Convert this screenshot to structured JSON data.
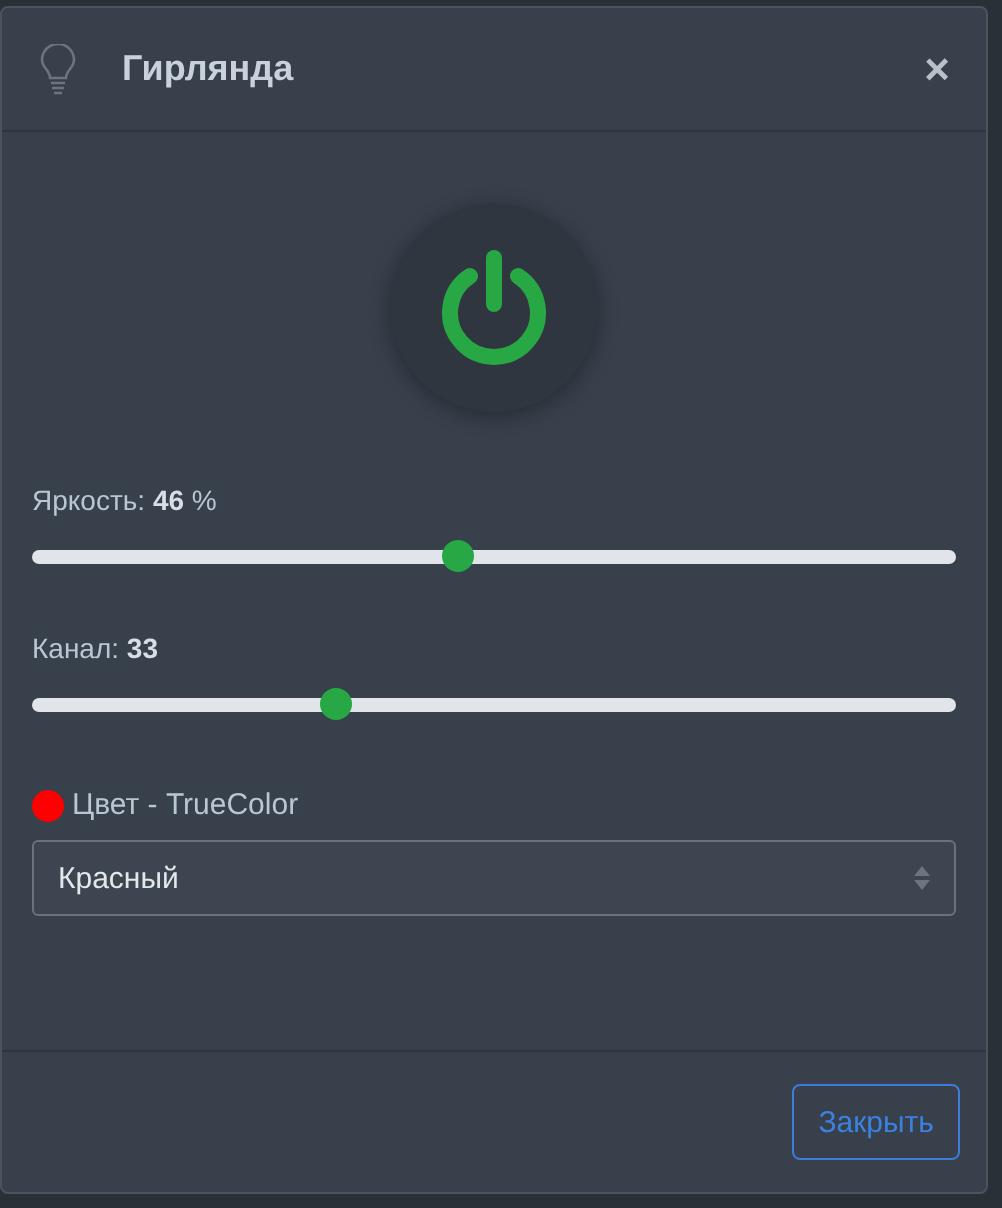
{
  "modal": {
    "title": "Гирлянда",
    "close_icon": "×"
  },
  "power": {
    "on": true
  },
  "sliders": [
    {
      "label": "Яркость: **46** %",
      "level": 0.46
    },
    {
      "label": "Канал: **33**",
      "level": 0.33
    }
  ],
  "color": {
    "label": "Цвет - TrueColor",
    "color": "#ff0000"
  },
  "select": {
    "value": "Красный"
  },
  "footer": {
    "close_button": "Закрыть"
  }
}
